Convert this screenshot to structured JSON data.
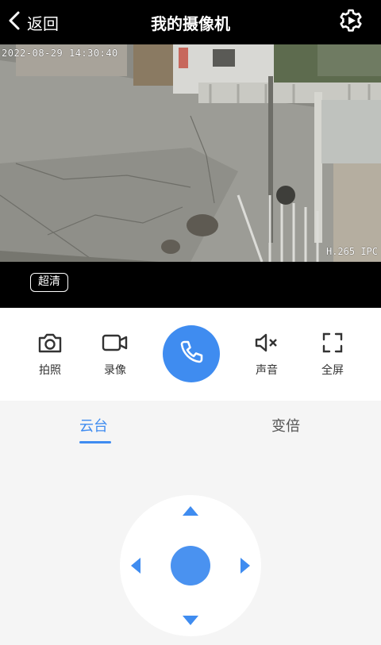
{
  "header": {
    "back_label": "返回",
    "title": "我的摄像机",
    "settings_icon": "gear-icon"
  },
  "video": {
    "timestamp": "2022-08-29 14:30:40",
    "codec": "H.265 IPC",
    "quality_label": "超清"
  },
  "controls": {
    "snapshot_label": "拍照",
    "record_label": "录像",
    "sound_label": "声音",
    "fullscreen_label": "全屏",
    "accent_color": "#3f8cf0"
  },
  "ptz_panel": {
    "tabs": [
      {
        "label": "云台",
        "active": true
      },
      {
        "label": "变倍",
        "active": false
      }
    ]
  }
}
